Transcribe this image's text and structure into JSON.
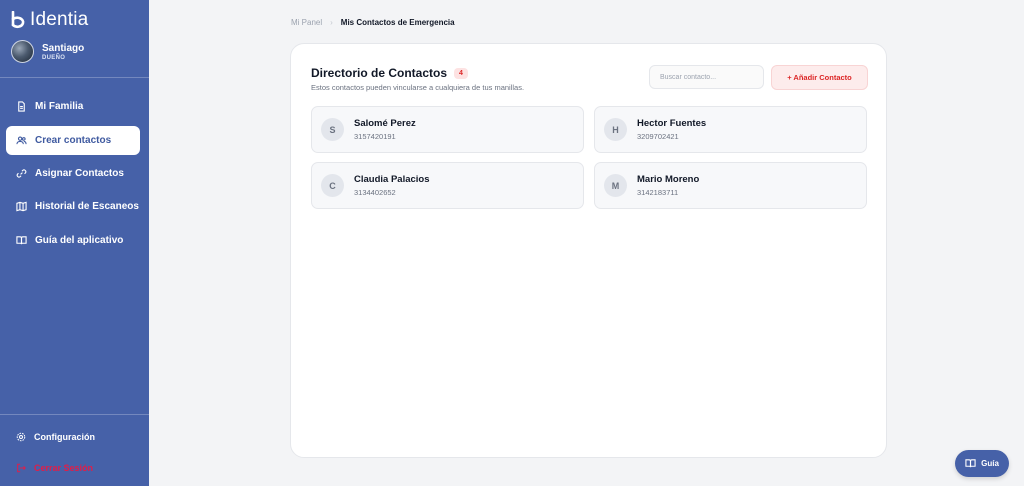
{
  "brand": {
    "name": "Identia"
  },
  "user": {
    "name": "Santiago",
    "role": "DUEÑO"
  },
  "nav": [
    {
      "label": "Mi Familia",
      "icon": "file-icon",
      "active": false
    },
    {
      "label": "Crear contactos",
      "icon": "users-icon",
      "active": true
    },
    {
      "label": "Asignar Contactos",
      "icon": "link-icon",
      "active": false
    },
    {
      "label": "Historial de Escaneos",
      "icon": "map-icon",
      "active": false
    },
    {
      "label": "Guía del aplicativo",
      "icon": "book-icon",
      "active": false
    }
  ],
  "footer_nav": {
    "settings": "Configuración",
    "logout": "Cerrar Sesión"
  },
  "breadcrumb": {
    "parent": "Mi Panel",
    "current": "Mis Contactos de Emergencia"
  },
  "directory": {
    "title": "Directorio de Contactos",
    "count": "4",
    "subtitle": "Estos contactos pueden vincularse a cualquiera de tus manillas.",
    "search_placeholder": "Buscar contacto...",
    "add_button": "+ Añadir Contacto"
  },
  "contacts": [
    {
      "initial": "S",
      "name": "Salomé Perez",
      "phone": "3157420191"
    },
    {
      "initial": "H",
      "name": "Hector Fuentes",
      "phone": "3209702421"
    },
    {
      "initial": "C",
      "name": "Claudia Palacios",
      "phone": "3134402652"
    },
    {
      "initial": "M",
      "name": "Mario Moreno",
      "phone": "3142183711"
    }
  ],
  "guide_button": "Guía",
  "colors": {
    "sidebar": "#4661a8",
    "accent_red": "#dc2626",
    "background": "#f3f4f6"
  }
}
